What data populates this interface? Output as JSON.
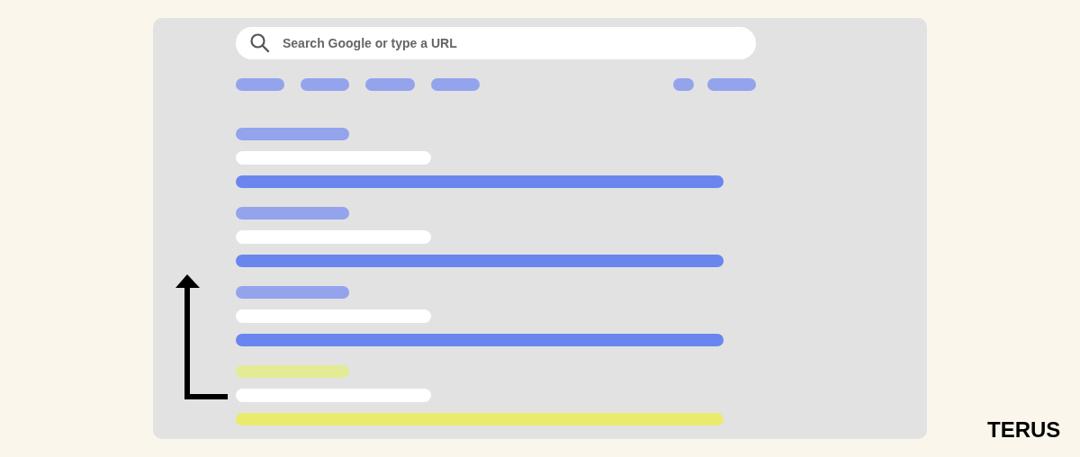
{
  "search": {
    "placeholder": "Search Google or type a URL"
  },
  "results": [
    {
      "highlighted": false
    },
    {
      "highlighted": false
    },
    {
      "highlighted": false
    },
    {
      "highlighted": true
    }
  ],
  "logo": "TERUS"
}
